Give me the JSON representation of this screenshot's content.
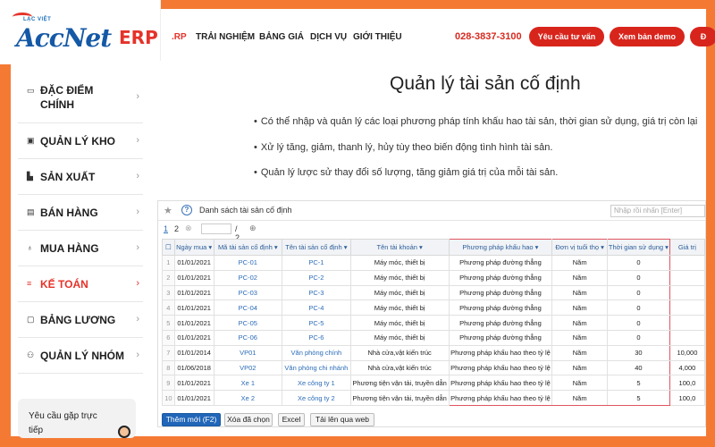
{
  "logo": {
    "tagline": "LẠC VIỆT",
    "name": "AccNet",
    "suffix": "ERP"
  },
  "topnav": {
    "items": [
      ".RP",
      "TRẢI NGHIỆM",
      "BẢNG GIÁ",
      "DỊCH VỤ",
      "GIỚI THIỆU"
    ],
    "phone": "028-3837-3100",
    "buttons": [
      "Yêu cầu tư vấn",
      "Xem bản demo",
      "Đ"
    ]
  },
  "sidebar": {
    "items": [
      {
        "icon": "monitor-icon",
        "label": "ĐẶC ĐIỂM CHÍNH"
      },
      {
        "icon": "warehouse-icon",
        "label": "QUẢN LÝ KHO"
      },
      {
        "icon": "factory-icon",
        "label": "SẢN XUẤT"
      },
      {
        "icon": "sales-icon",
        "label": "BÁN HÀNG"
      },
      {
        "icon": "purchase-icon",
        "label": "MUA HÀNG"
      },
      {
        "icon": "accounting-icon",
        "label": "KẾ TOÁN"
      },
      {
        "icon": "payroll-icon",
        "label": "BẢNG LƯƠNG"
      },
      {
        "icon": "group-icon",
        "label": "QUẢN LÝ NHÓM"
      }
    ],
    "active_index": 5,
    "support_text": "Yêu cầu gặp trực tiếp"
  },
  "main": {
    "title": "Quản lý tài sản cố định",
    "bullets": [
      "Có thể nhập và quản lý các loại phương pháp tính khấu hao tài sản, thời gian sử dụng, giá trị còn lại",
      "Xử lý tăng, giảm, thanh lý, hủy tùy theo biến động tình hình tài sản.",
      "Quản lý lược sử thay đổi số lượng, tăng giảm giá trị của mỗi tài sản."
    ]
  },
  "grid": {
    "title": "Danh sách tài sản cố định",
    "search_placeholder": "Nhập rồi nhấn [Enter]",
    "pager": {
      "current": "1",
      "next": "2",
      "total": "/ 2"
    },
    "columns": [
      "Ngày mua ▾",
      "Mã tài sản cố định ▾",
      "Tên tài sản cố định ▾",
      "Tên tài khoản ▾",
      "Phương pháp khấu hao ▾",
      "Đơn vị tuổi thọ ▾",
      "Thời gian sử dụng ▾",
      "Giá trị"
    ],
    "rows": [
      [
        "1",
        "01/01/2021",
        "PC-01",
        "PC-1",
        "Máy móc, thiết bị",
        "Phương pháp đường thẳng",
        "Năm",
        "0",
        ""
      ],
      [
        "2",
        "01/01/2021",
        "PC-02",
        "PC-2",
        "Máy móc, thiết bị",
        "Phương pháp đường thẳng",
        "Năm",
        "0",
        ""
      ],
      [
        "3",
        "01/01/2021",
        "PC-03",
        "PC-3",
        "Máy móc, thiết bị",
        "Phương pháp đường thẳng",
        "Năm",
        "0",
        ""
      ],
      [
        "4",
        "01/01/2021",
        "PC-04",
        "PC-4",
        "Máy móc, thiết bị",
        "Phương pháp đường thẳng",
        "Năm",
        "0",
        ""
      ],
      [
        "5",
        "01/01/2021",
        "PC-05",
        "PC-5",
        "Máy móc, thiết bị",
        "Phương pháp đường thẳng",
        "Năm",
        "0",
        ""
      ],
      [
        "6",
        "01/01/2021",
        "PC-06",
        "PC-6",
        "Máy móc, thiết bị",
        "Phương pháp đường thẳng",
        "Năm",
        "0",
        ""
      ],
      [
        "7",
        "01/01/2014",
        "VP01",
        "Văn phòng chính",
        "Nhà cửa,vật kiến trúc",
        "Phương pháp khấu hao theo tỷ lệ",
        "Năm",
        "30",
        "10,000"
      ],
      [
        "8",
        "01/06/2018",
        "VP02",
        "Văn phòng chi nhánh",
        "Nhà cửa,vật kiến trúc",
        "Phương pháp khấu hao theo tỷ lệ",
        "Năm",
        "40",
        "4,000"
      ],
      [
        "9",
        "01/01/2021",
        "Xe 1",
        "Xe công ty 1",
        "Phương tiện vận tải, truyền dẫn",
        "Phương pháp khấu hao theo tỷ lệ",
        "Năm",
        "5",
        "100,0"
      ],
      [
        "10",
        "01/01/2021",
        "Xe 2",
        "Xe công ty 2",
        "Phương tiện vận tải, truyền dẫn",
        "Phương pháp khấu hao theo tỷ lệ",
        "Năm",
        "5",
        "100,0"
      ]
    ],
    "footer_buttons": [
      "Thêm mới (F2)",
      "Xóa đã chọn",
      "Excel",
      "Tải lên qua web"
    ]
  },
  "colors": {
    "frame": "#f47a34",
    "brand_blue": "#1559a6",
    "brand_red": "#e5332a",
    "highlight": "#e0555f"
  }
}
